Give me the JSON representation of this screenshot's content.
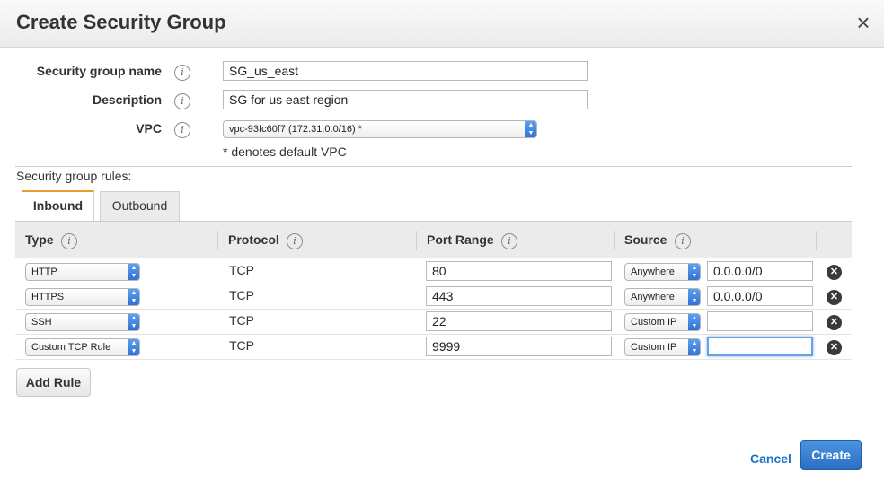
{
  "dialog": {
    "title": "Create Security Group",
    "close_glyph": "×"
  },
  "form": {
    "name_label": "Security group name",
    "name_value": "SG_us_east",
    "description_label": "Description",
    "description_value": "SG for us east region",
    "vpc_label": "VPC",
    "vpc_value": "vpc-93fc60f7 (172.31.0.0/16) *",
    "vpc_note": "* denotes default VPC",
    "info_glyph": "i"
  },
  "rules": {
    "label": "Security group rules:",
    "tabs": [
      {
        "label": "Inbound",
        "active": true
      },
      {
        "label": "Outbound",
        "active": false
      }
    ],
    "columns": [
      "Type",
      "Protocol",
      "Port Range",
      "Source"
    ],
    "rows": [
      {
        "type": "HTTP",
        "protocol": "TCP",
        "port": "80",
        "source_type": "Anywhere",
        "source_value": "0.0.0.0/0"
      },
      {
        "type": "HTTPS",
        "protocol": "TCP",
        "port": "443",
        "source_type": "Anywhere",
        "source_value": "0.0.0.0/0"
      },
      {
        "type": "SSH",
        "protocol": "TCP",
        "port": "22",
        "source_type": "Custom IP",
        "source_value": ""
      },
      {
        "type": "Custom TCP Rule",
        "protocol": "TCP",
        "port": "9999",
        "source_type": "Custom IP",
        "source_value": ""
      }
    ],
    "delete_glyph": "✕",
    "add_rule_label": "Add Rule"
  },
  "footer": {
    "cancel_label": "Cancel",
    "create_label": "Create"
  },
  "colors": {
    "accent_tab": "#ec9b31",
    "primary_button": "#2a6ec4",
    "link": "#1b73c8"
  }
}
